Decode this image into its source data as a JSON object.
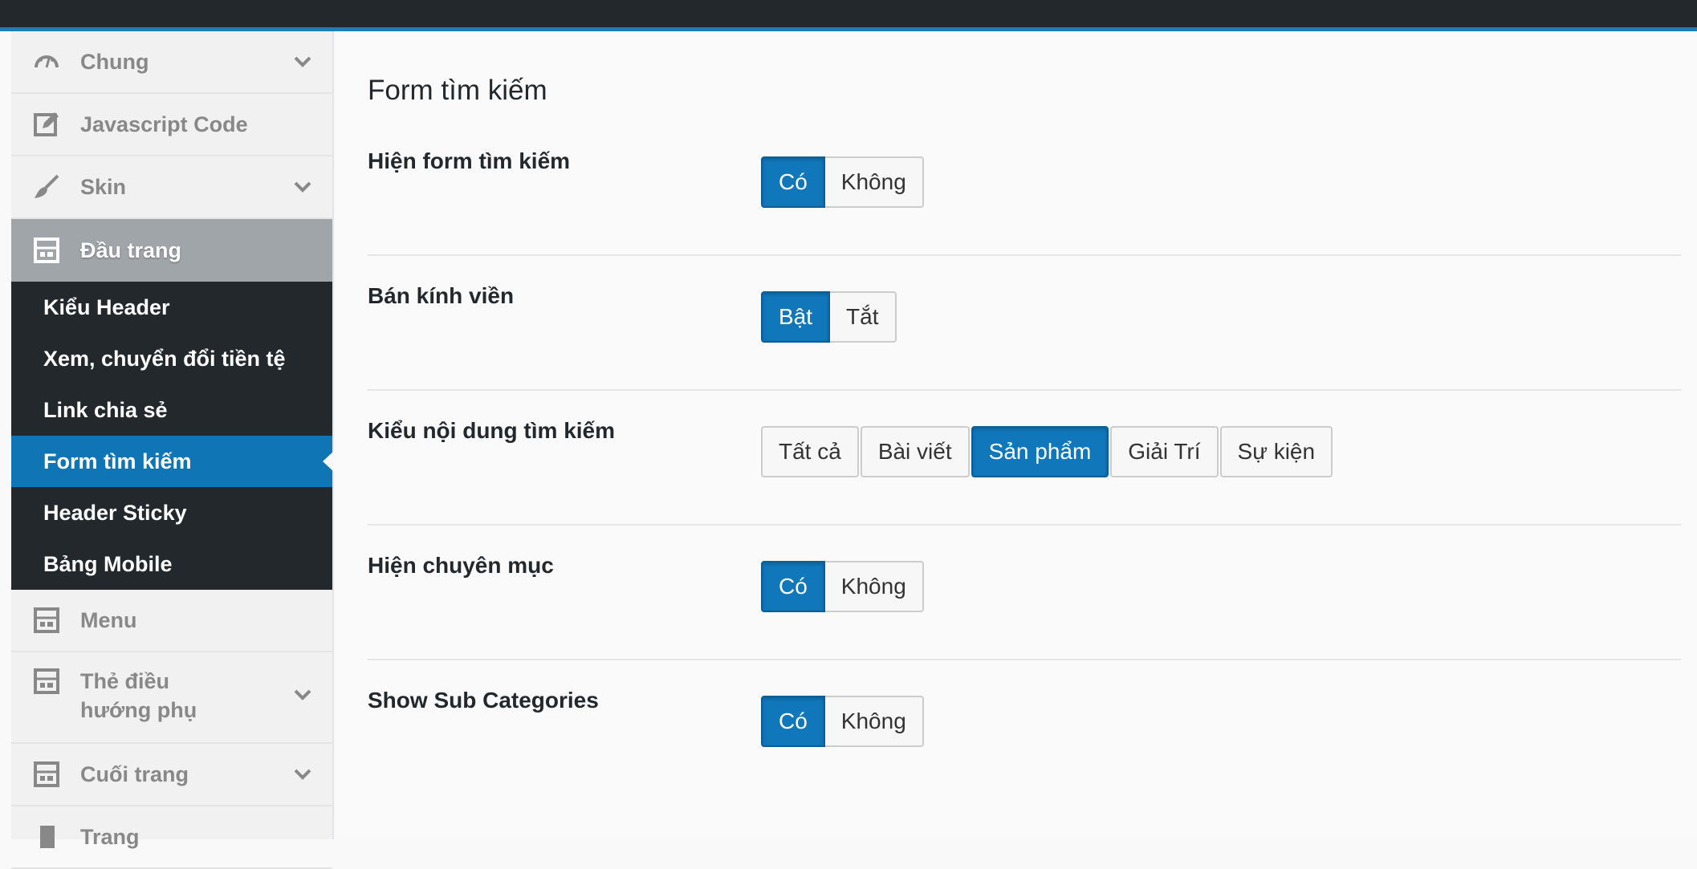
{
  "sidebar": {
    "items": [
      {
        "label": "Chung",
        "icon": "dashboard-icon",
        "has_chevron": true
      },
      {
        "label": "Javascript Code",
        "icon": "edit-icon",
        "has_chevron": false
      },
      {
        "label": "Skin",
        "icon": "brush-icon",
        "has_chevron": true
      },
      {
        "label": "Đầu trang",
        "icon": "layout-icon",
        "has_chevron": false
      }
    ],
    "submenu": [
      {
        "label": "Kiểu Header"
      },
      {
        "label": "Xem, chuyển đổi tiền tệ"
      },
      {
        "label": "Link chia sẻ"
      },
      {
        "label": "Form tìm kiếm",
        "current": true
      },
      {
        "label": "Header Sticky"
      },
      {
        "label": "Bảng Mobile"
      }
    ],
    "items_after": [
      {
        "label": "Menu",
        "icon": "layout-icon",
        "has_chevron": false
      },
      {
        "label": "Thẻ điều hướng phụ",
        "icon": "layout-icon",
        "has_chevron": true
      },
      {
        "label": "Cuối trang",
        "icon": "layout-icon",
        "has_chevron": true
      },
      {
        "label": "Trang",
        "icon": "page-icon",
        "has_chevron": false
      }
    ]
  },
  "main": {
    "title": "Form tìm kiếm",
    "settings": [
      {
        "label": "Hiện form tìm kiếm",
        "options": [
          "Có",
          "Không"
        ],
        "selected": "Có"
      },
      {
        "label": "Bán kính viền",
        "options": [
          "Bật",
          "Tắt"
        ],
        "selected": "Bật"
      },
      {
        "label": "Kiểu nội dung tìm kiếm",
        "options": [
          "Tất cả",
          "Bài viết",
          "Sản phẩm",
          "Giải Trí",
          "Sự kiện"
        ],
        "selected": "Sản phẩm"
      },
      {
        "label": "Hiện chuyên mục",
        "options": [
          "Có",
          "Không"
        ],
        "selected": "Có"
      },
      {
        "label": "Show Sub Categories",
        "options": [
          "Có",
          "Không"
        ],
        "selected": "Có"
      }
    ]
  },
  "colors": {
    "admin_bar": "#23282d",
    "accent": "#0f75b5",
    "active_button": "#1177bb",
    "sidebar_active_parent": "#a0a5aa"
  }
}
